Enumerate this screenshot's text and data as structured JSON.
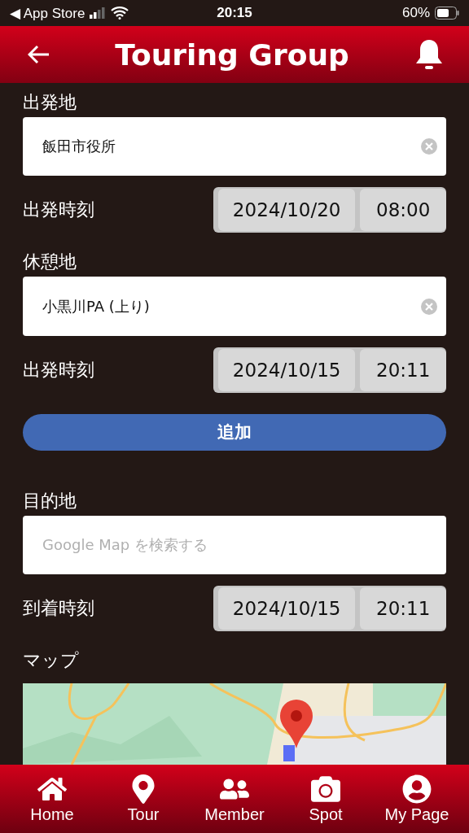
{
  "status_bar": {
    "back_label": "◀ App Store",
    "time": "20:15",
    "battery": "60%"
  },
  "header": {
    "title": "Touring Group"
  },
  "form": [
    {
      "kind": "label",
      "text": "出発地"
    },
    {
      "kind": "place",
      "value": "飯田市役所"
    },
    {
      "kind": "datetime",
      "label": "出発時刻",
      "date": "2024/10/20",
      "time": "08:00"
    },
    {
      "kind": "label",
      "text": "休憩地"
    },
    {
      "kind": "place",
      "value": "小黒川PA (上り)"
    },
    {
      "kind": "datetime",
      "label": "出発時刻",
      "date": "2024/10/15",
      "time": "20:11"
    },
    {
      "kind": "button",
      "text": "追加"
    },
    {
      "kind": "label",
      "text": "目的地"
    },
    {
      "kind": "place",
      "placeholder": "Google Map を検索する"
    },
    {
      "kind": "datetime",
      "label": "到着時刻",
      "date": "2024/10/15",
      "time": "20:11"
    },
    {
      "kind": "label",
      "text": "マップ"
    },
    {
      "kind": "map"
    }
  ],
  "tab_bar": [
    {
      "kind": "home",
      "label": "Home"
    },
    {
      "kind": "tour",
      "label": "Tour"
    },
    {
      "kind": "member",
      "label": "Member"
    },
    {
      "kind": "spot",
      "label": "Spot"
    },
    {
      "kind": "mypage",
      "label": "My Page"
    }
  ]
}
